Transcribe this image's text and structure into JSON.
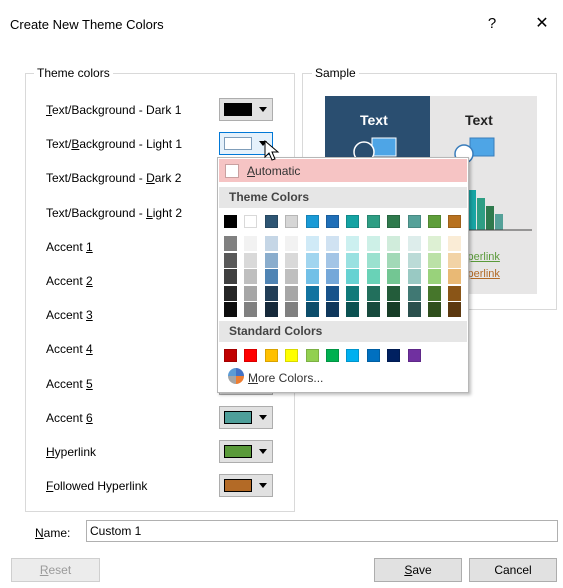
{
  "dialog": {
    "title": "Create New Theme Colors",
    "help": "?",
    "close": "✕"
  },
  "theme_colors": {
    "legend": "Theme colors",
    "rows": [
      {
        "label_pre": "",
        "label_u": "T",
        "label_post": "ext/Background - Dark 1",
        "color": "#000000",
        "active": false
      },
      {
        "label_pre": "Text/",
        "label_u": "B",
        "label_post": "ackground - Light 1",
        "color": "#ffffff",
        "active": true
      },
      {
        "label_pre": "Text/Background - ",
        "label_u": "D",
        "label_post": "ark 2",
        "color": "#44546a",
        "active": false
      },
      {
        "label_pre": "Text/Background - ",
        "label_u": "L",
        "label_post": "ight 2",
        "color": "#e7e6e6",
        "active": false
      },
      {
        "label_pre": "Accent ",
        "label_u": "1",
        "label_post": "",
        "color": "#4472c4",
        "active": false
      },
      {
        "label_pre": "Accent ",
        "label_u": "2",
        "label_post": "",
        "color": "#ed7d31",
        "active": false
      },
      {
        "label_pre": "Accent ",
        "label_u": "3",
        "label_post": "",
        "color": "#a5a5a5",
        "active": false
      },
      {
        "label_pre": "Accent ",
        "label_u": "4",
        "label_post": "",
        "color": "#ffc000",
        "active": false
      },
      {
        "label_pre": "Accent ",
        "label_u": "5",
        "label_post": "",
        "color": "#5b9bd5",
        "active": false
      },
      {
        "label_pre": "Accent ",
        "label_u": "6",
        "label_post": "",
        "color": "#4e9f9a",
        "active": false
      },
      {
        "label_pre": "",
        "label_u": "H",
        "label_post": "yperlink",
        "color": "#5a9a3a",
        "active": false
      },
      {
        "label_pre": "",
        "label_u": "F",
        "label_post": "ollowed Hyperlink",
        "color": "#b36a26",
        "active": false
      }
    ]
  },
  "sample": {
    "legend": "Sample",
    "dark_text": "Text",
    "light_text": "Text",
    "hyperlink_fragment": "yperlink",
    "followed_fragment": "yperlink",
    "colors": {
      "dark_bg": "#2a4e70",
      "light_bg": "#e7e6e6",
      "hyperlink": "#5a9a3a",
      "followed": "#b36a26"
    }
  },
  "dropdown": {
    "automatic_u": "A",
    "automatic_rest": "utomatic",
    "theme_colors_heading": "Theme Colors",
    "standard_colors_heading": "Standard Colors",
    "more_colors_u": "M",
    "more_colors_rest": "ore Colors...",
    "theme_top": [
      "#000000",
      "#ffffff",
      "#2e5573",
      "#d6d6d6",
      "#1a9ad6",
      "#1f6fb8",
      "#15a3a3",
      "#2e9e84",
      "#2f7a4d",
      "#55a199",
      "#5e9e3a",
      "#b8711f"
    ],
    "theme_columns": [
      [
        "#808080",
        "#595959",
        "#404040",
        "#262626",
        "#0d0d0d"
      ],
      [
        "#f2f2f2",
        "#d9d9d9",
        "#bfbfbf",
        "#a6a6a6",
        "#808080"
      ],
      [
        "#c5d6e6",
        "#8aadcd",
        "#4f84b4",
        "#223e57",
        "#16293a"
      ],
      [
        "#f2f2f2",
        "#d9d9d9",
        "#bfbfbf",
        "#a6a6a6",
        "#808080"
      ],
      [
        "#d0eaf7",
        "#a1d5ef",
        "#72c0e7",
        "#1273a0",
        "#0c4d6b"
      ],
      [
        "#d0e2f2",
        "#a3c5e6",
        "#75a8d9",
        "#17538a",
        "#0f375c"
      ],
      [
        "#ccf0f0",
        "#99e1e1",
        "#66d2d2",
        "#107a7a",
        "#0b5252"
      ],
      [
        "#cdf0e7",
        "#9be1cf",
        "#69d2b7",
        "#226f5c",
        "#174a3d"
      ],
      [
        "#d0ecdb",
        "#a2d9b7",
        "#73c693",
        "#235c3a",
        "#173d27"
      ],
      [
        "#ddedeb",
        "#bbdbd7",
        "#99c9c3",
        "#407873",
        "#2a504d"
      ],
      [
        "#ddf0d3",
        "#bbe1a7",
        "#99d27b",
        "#46762b",
        "#2f4f1d"
      ],
      [
        "#faecd6",
        "#f2d3a6",
        "#e9b975",
        "#8a5517",
        "#5c380f"
      ]
    ],
    "standard": [
      "#c00000",
      "#ff0000",
      "#ffc000",
      "#ffff00",
      "#92d050",
      "#00b050",
      "#00b0f0",
      "#0070c0",
      "#002060",
      "#7030a0"
    ]
  },
  "name_field": {
    "label_u": "N",
    "label_rest": "ame:",
    "value": "Custom 1"
  },
  "buttons": {
    "reset_u": "R",
    "reset_rest": "eset",
    "save_u": "S",
    "save_rest": "ave",
    "cancel": "Cancel"
  }
}
